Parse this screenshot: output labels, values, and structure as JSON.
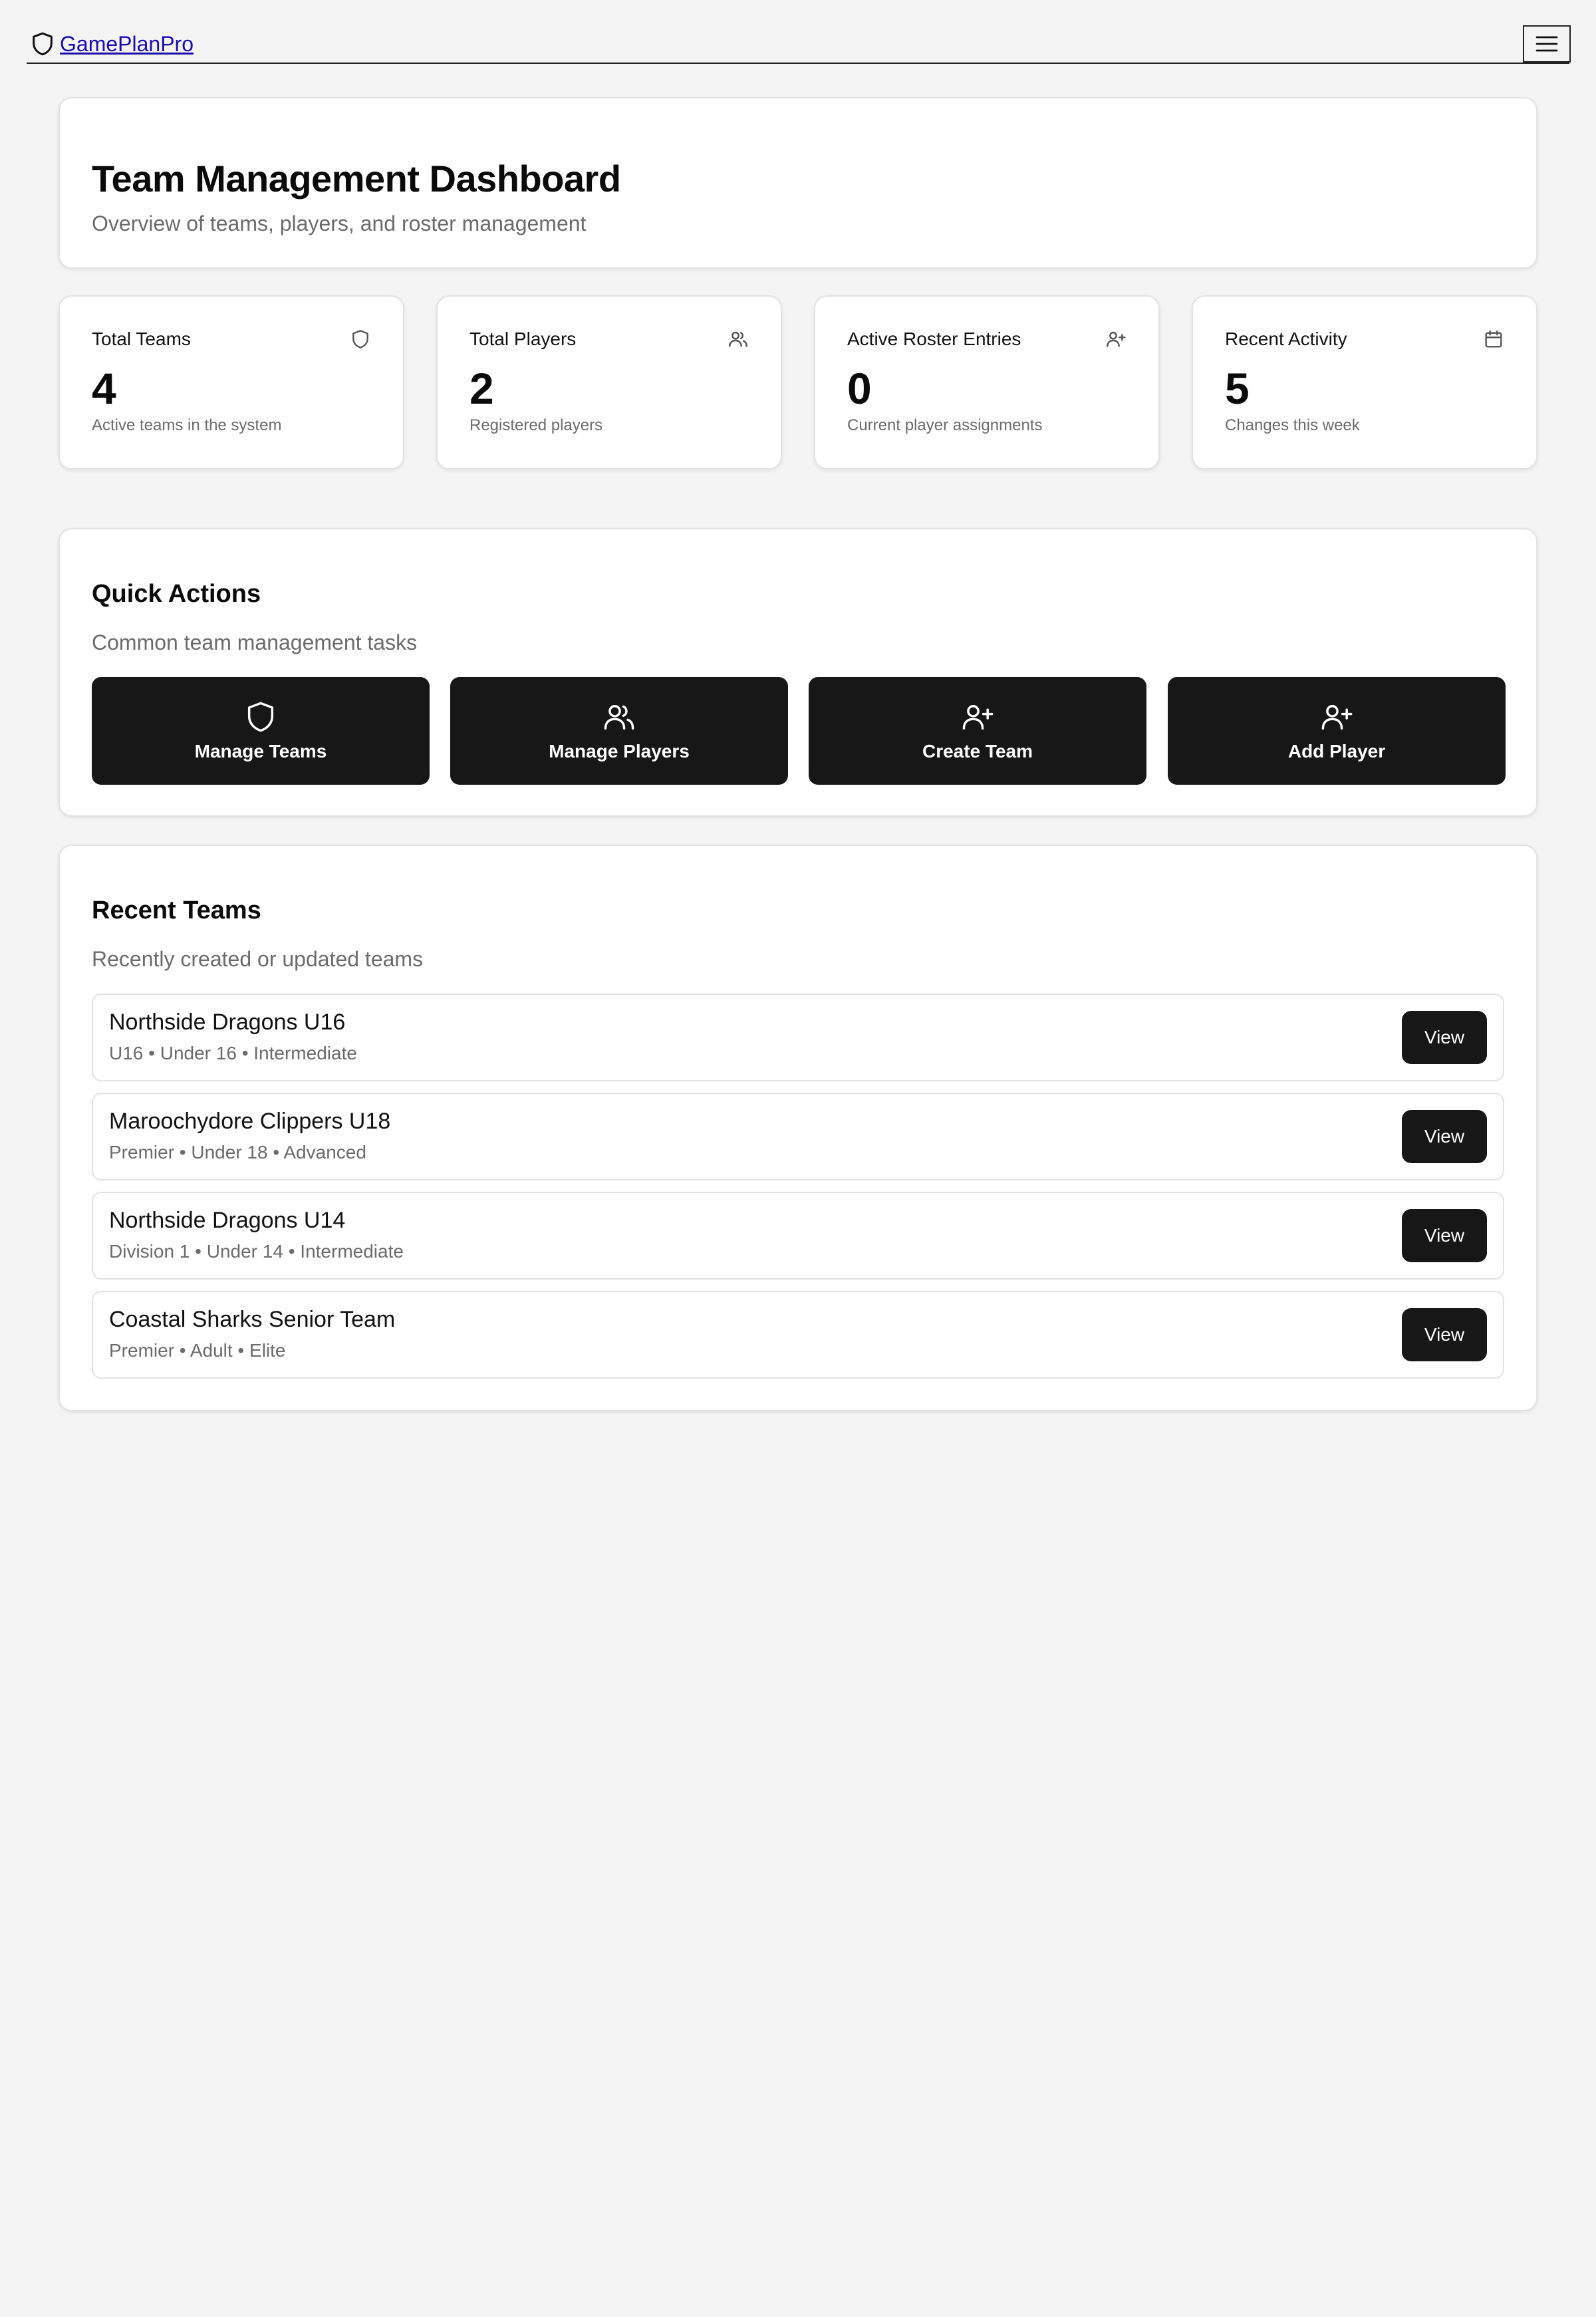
{
  "nav": {
    "brand": "GamePlanPro",
    "brand_icon": "shield-icon",
    "menu_icon": "hamburger-menu-icon"
  },
  "header": {
    "title": "Team Management Dashboard",
    "subtitle": "Overview of teams, players, and roster management"
  },
  "stats": [
    {
      "label": "Total Teams",
      "value": "4",
      "description": "Active teams in the system",
      "icon": "shield-icon"
    },
    {
      "label": "Total Players",
      "value": "2",
      "description": "Registered players",
      "icon": "users-icon"
    },
    {
      "label": "Active Roster Entries",
      "value": "0",
      "description": "Current player assignments",
      "icon": "user-plus-icon"
    },
    {
      "label": "Recent Activity",
      "value": "5",
      "description": "Changes this week",
      "icon": "calendar-icon"
    }
  ],
  "quick_actions": {
    "title": "Quick Actions",
    "subtitle": "Common team management tasks",
    "buttons": [
      {
        "label": "Manage Teams",
        "icon": "shield-icon"
      },
      {
        "label": "Manage Players",
        "icon": "users-icon"
      },
      {
        "label": "Create Team",
        "icon": "user-plus-icon"
      },
      {
        "label": "Add Player",
        "icon": "user-plus-icon"
      }
    ]
  },
  "recent_teams": {
    "title": "Recent Teams",
    "subtitle": "Recently created or updated teams",
    "teams": [
      {
        "name": "Northside Dragons U16",
        "meta": "U16 • Under 16 • Intermediate",
        "action": "View"
      },
      {
        "name": "Maroochydore Clippers U18",
        "meta": "Premier • Under 18 • Advanced",
        "action": "View"
      },
      {
        "name": "Northside Dragons U14",
        "meta": "Division 1 • Under 14 • Intermediate",
        "action": "View"
      },
      {
        "name": "Coastal Sharks Senior Team",
        "meta": "Premier • Adult • Elite",
        "action": "View"
      }
    ]
  },
  "colors": {
    "background": "#f4f4f4",
    "card": "#ffffff",
    "button": "#171717",
    "muted_text": "#6b6b6b",
    "link": "#1a0dab"
  }
}
